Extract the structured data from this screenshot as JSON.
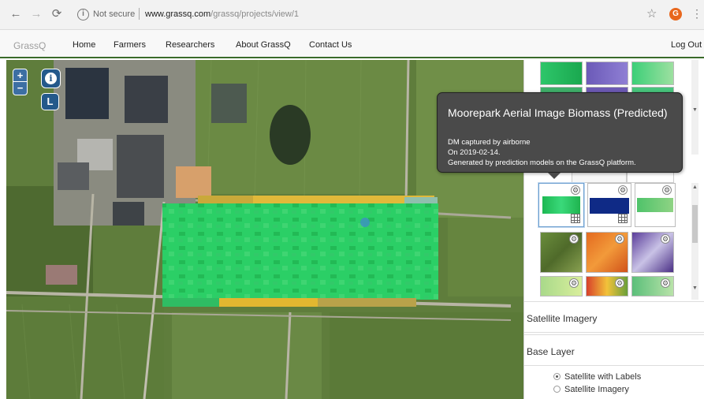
{
  "browser": {
    "url_security": "Not secure",
    "url_host": "www.grassq.com",
    "url_path": "/grassq/projects/view/1",
    "profile_initial": "G"
  },
  "site": {
    "brand": "GrassQ",
    "nav": [
      "Home",
      "Farmers",
      "Researchers",
      "About GrassQ",
      "Contact Us"
    ],
    "logout": "Log Out"
  },
  "map": {
    "zoom_in": "+",
    "zoom_out": "−",
    "info_glyph": "i",
    "layer_button": "L"
  },
  "tooltip": {
    "title": "Moorepark Aerial Image Biomass (Predicted)",
    "line1": "DM captured by airborne",
    "line2": "On 2019-02-14.",
    "line3": "Generated by prediction models on the GrassQ platform."
  },
  "sidebar": {
    "satellite_imagery_header": "Satellite Imagery",
    "base_layer_header": "Base Layer",
    "base_layer_options": [
      {
        "label": "Satellite with Labels",
        "checked": true
      },
      {
        "label": "Satellite Imagery",
        "checked": false
      }
    ]
  },
  "colors": {
    "accent": "#24598b",
    "navbar_border": "#3a6b2a",
    "tooltip_bg": "#4a4a4a"
  }
}
